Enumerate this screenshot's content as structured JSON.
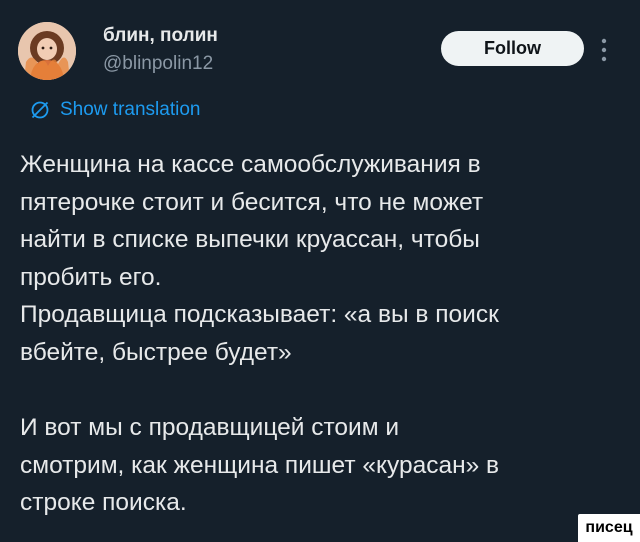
{
  "author": {
    "display_name": "блин, полин",
    "handle": "@blinpolin12",
    "avatar_icon": "avatar-image"
  },
  "actions": {
    "follow_label": "Follow",
    "more_icon": "more-vertical-icon"
  },
  "translation": {
    "label": "Show translation",
    "icon": "translate-icon"
  },
  "tweet": {
    "lines": [
      "Женщина на кассе самообслуживания в",
      "пятерочке стоит и бесится, что не может",
      "найти в списке выпечки круассан, чтобы",
      "пробить его.",
      "Продавщица подсказывает: «а вы в поиск",
      "вбейте, быстрее будет»",
      "",
      "И вот мы с продавщицей стоим и",
      "смотрим, как женщина пишет «курасан» в",
      "строке поиска."
    ]
  },
  "watermark": {
    "text": "писец"
  },
  "colors": {
    "background": "#15202b",
    "text": "#e7e9ea",
    "secondary": "#8b98a5",
    "link": "#1d9bf0",
    "button_bg": "#eff3f4"
  }
}
